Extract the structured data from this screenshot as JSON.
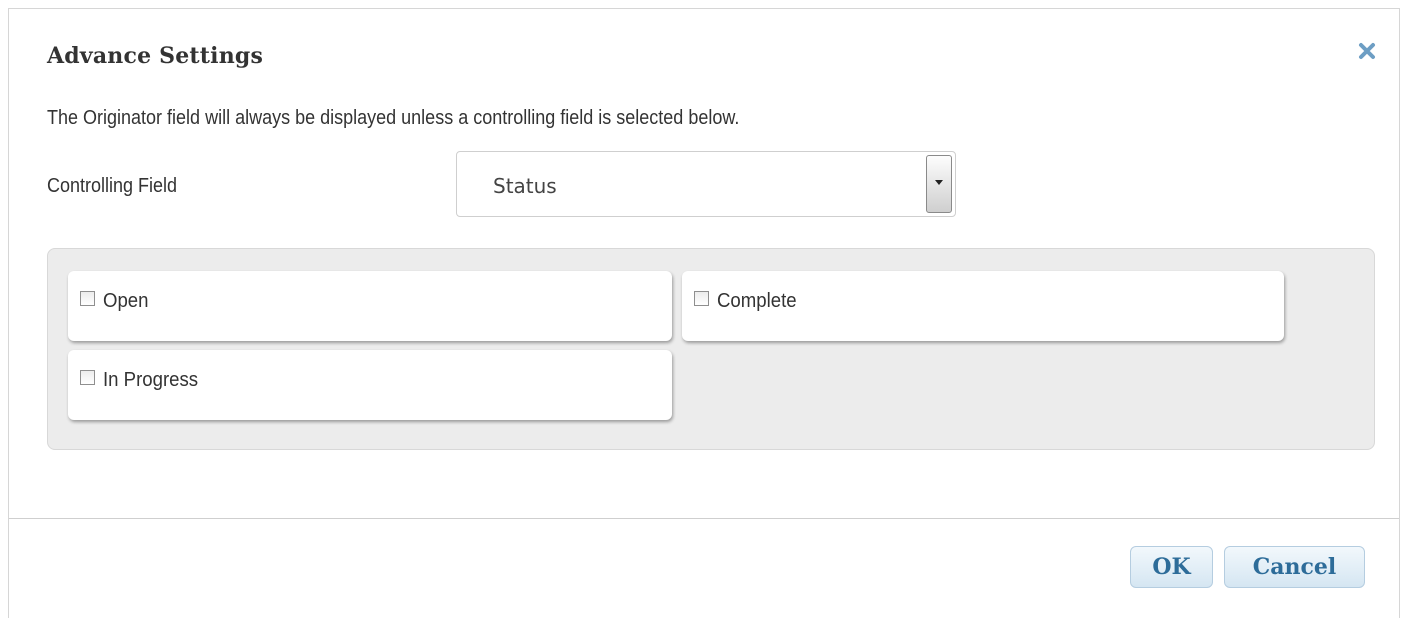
{
  "dialog": {
    "title": "Advance Settings",
    "close_icon": "close-x-icon",
    "description": "The Originator field will always be displayed unless a controlling field is selected below."
  },
  "controlling_field": {
    "label": "Controlling Field",
    "selected": "Status"
  },
  "options": [
    {
      "label": "Open",
      "checked": false
    },
    {
      "label": "Complete",
      "checked": false
    },
    {
      "label": "In Progress",
      "checked": false
    }
  ],
  "buttons": {
    "ok": "OK",
    "cancel": "Cancel"
  },
  "colors": {
    "button_text": "#2d6c99",
    "close_icon": "#6d9ec4",
    "panel_background": "#ececec"
  }
}
